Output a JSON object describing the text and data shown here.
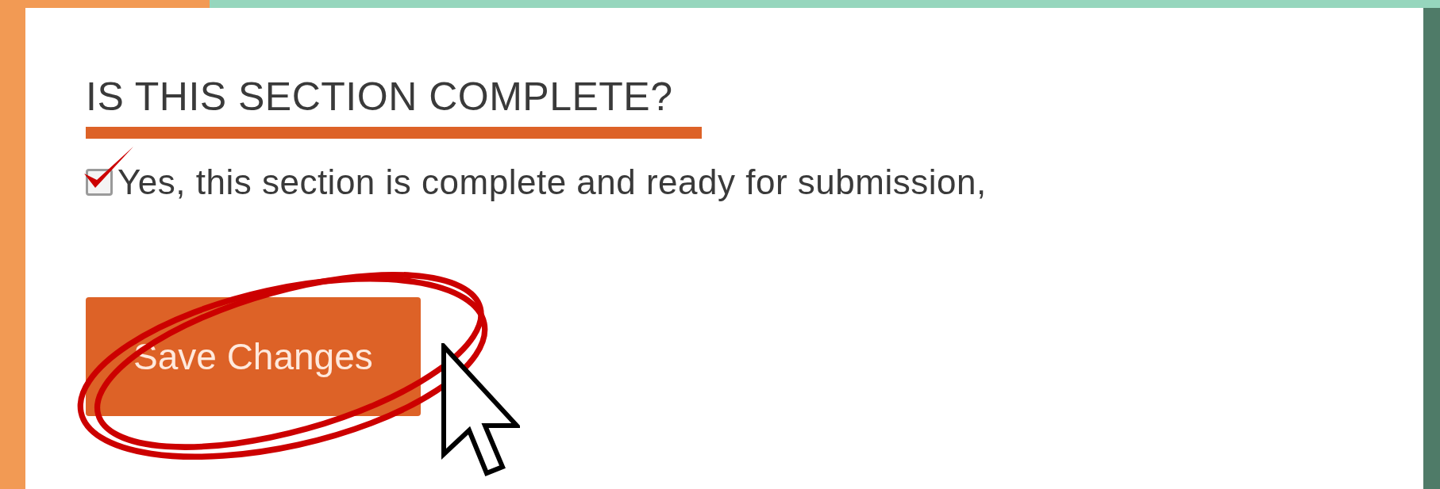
{
  "section": {
    "heading": "IS THIS SECTION COMPLETE?"
  },
  "confirm": {
    "label": "Yes, this section is complete and ready for submission,",
    "checked": true
  },
  "save_button": {
    "label": "Save Changes"
  }
}
